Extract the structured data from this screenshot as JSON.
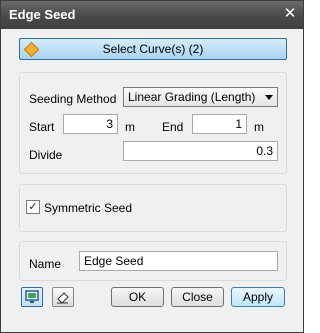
{
  "window": {
    "title": "Edge Seed",
    "close_symbol": "✕"
  },
  "select_curves": {
    "label": "Select Curve(s) (2)",
    "icon": "diamond-icon"
  },
  "seeding": {
    "method_label": "Seeding Method",
    "method_value": "Linear Grading (Length)",
    "start_label": "Start",
    "start_value": "3",
    "start_unit": "m",
    "end_label": "End",
    "end_value": "1",
    "end_unit": "m",
    "divide_label": "Divide",
    "divide_value": "0.3"
  },
  "symmetric": {
    "label": "Symmetric Seed",
    "checked": true,
    "check_mark": "✓"
  },
  "name": {
    "label": "Name",
    "value": "Edge Seed"
  },
  "footer": {
    "icons": [
      "monitor-icon",
      "eraser-icon"
    ],
    "ok_label": "OK",
    "close_label": "Close",
    "apply_label": "Apply"
  },
  "colors": {
    "titlebar": "#4a4a4a",
    "accent": "#a8d4f1",
    "selection": "#2c6ea5"
  }
}
